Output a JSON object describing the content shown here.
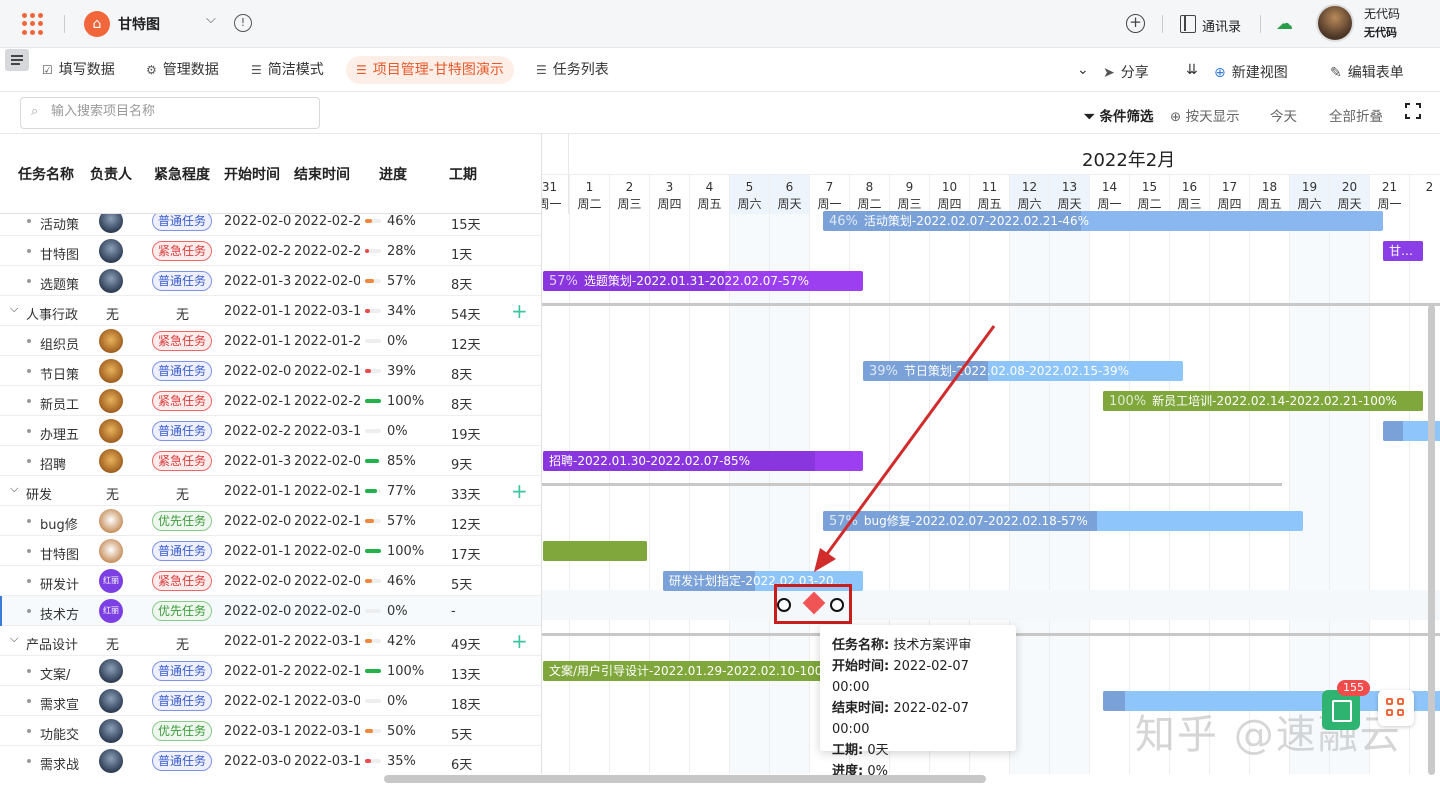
{
  "topbar": {
    "app_title": "甘特图",
    "contacts": "通讯录",
    "user_name": "无代码",
    "user_org": "无代码"
  },
  "tabs": [
    {
      "label": "填写数据",
      "icon": "form-icon"
    },
    {
      "label": "管理数据",
      "icon": "gear-icon"
    },
    {
      "label": "简洁模式",
      "icon": "gantt-icon"
    },
    {
      "label": "项目管理-甘特图演示",
      "icon": "gantt-icon",
      "active": true
    },
    {
      "label": "任务列表",
      "icon": "gantt-icon"
    }
  ],
  "tab_actions": {
    "share": "分享",
    "new_view": "新建视图",
    "edit_form": "编辑表单"
  },
  "toolbar": {
    "search_placeholder": "输入搜索项目名称",
    "filter": "条件筛选",
    "by_day": "按天显示",
    "today": "今天",
    "collapse_all": "全部折叠"
  },
  "columns": [
    "任务名称",
    "负责人",
    "紧急程度",
    "开始时间",
    "结束时间",
    "进度",
    "工期"
  ],
  "rows": [
    {
      "type": "task",
      "name": "活动策",
      "owner": "city",
      "owner_label": "",
      "priority": "普通任务",
      "ptype": "normal",
      "start": "2022-02-0",
      "end": "2022-02-2",
      "progress": "46%",
      "pval": 46,
      "dur": "15天"
    },
    {
      "type": "task",
      "name": "甘特图",
      "owner": "city",
      "owner_label": "",
      "priority": "紧急任务",
      "ptype": "urgent",
      "start": "2022-02-2",
      "end": "2022-02-2",
      "progress": "28%",
      "pval": 28,
      "dur": "1天"
    },
    {
      "type": "task",
      "name": "选题策",
      "owner": "city",
      "owner_label": "",
      "priority": "普通任务",
      "ptype": "normal",
      "start": "2022-01-3",
      "end": "2022-02-0",
      "progress": "57%",
      "pval": 57,
      "dur": "8天"
    },
    {
      "type": "group",
      "name": "人事行政",
      "owner_text": "无",
      "priority_text": "无",
      "start": "2022-01-1",
      "end": "2022-03-1",
      "progress": "34%",
      "pval": 34,
      "dur": "54天"
    },
    {
      "type": "task",
      "name": "组织员",
      "owner": "lion",
      "owner_label": "",
      "priority": "紧急任务",
      "ptype": "urgent",
      "start": "2022-01-1",
      "end": "2022-01-2",
      "progress": "0%",
      "pval": 0,
      "dur": "12天"
    },
    {
      "type": "task",
      "name": "节日策",
      "owner": "lion",
      "owner_label": "",
      "priority": "普通任务",
      "ptype": "normal",
      "start": "2022-02-0",
      "end": "2022-02-1",
      "progress": "39%",
      "pval": 39,
      "dur": "8天"
    },
    {
      "type": "task",
      "name": "新员工",
      "owner": "lion",
      "owner_label": "",
      "priority": "紧急任务",
      "ptype": "urgent",
      "start": "2022-02-1",
      "end": "2022-02-2",
      "progress": "100%",
      "pval": 100,
      "dur": "8天"
    },
    {
      "type": "task",
      "name": "办理五",
      "owner": "lion",
      "owner_label": "",
      "priority": "普通任务",
      "ptype": "normal",
      "start": "2022-02-2",
      "end": "2022-03-1",
      "progress": "0%",
      "pval": 0,
      "dur": "19天"
    },
    {
      "type": "task",
      "name": "招聘",
      "owner": "lion",
      "owner_label": "",
      "priority": "紧急任务",
      "ptype": "urgent",
      "start": "2022-01-3",
      "end": "2022-02-0",
      "progress": "85%",
      "pval": 85,
      "dur": "9天"
    },
    {
      "type": "group",
      "name": "研发",
      "owner_text": "无",
      "priority_text": "无",
      "start": "2022-01-1",
      "end": "2022-02-1",
      "progress": "77%",
      "pval": 77,
      "dur": "33天"
    },
    {
      "type": "task",
      "name": "bug修",
      "owner": "dog",
      "owner_label": "",
      "priority": "优先任务",
      "ptype": "prior",
      "start": "2022-02-0",
      "end": "2022-02-1",
      "progress": "57%",
      "pval": 57,
      "dur": "12天"
    },
    {
      "type": "task",
      "name": "甘特图",
      "owner": "dog",
      "owner_label": "",
      "priority": "普通任务",
      "ptype": "normal",
      "start": "2022-01-1",
      "end": "2022-02-0",
      "progress": "100%",
      "pval": 100,
      "dur": "17天"
    },
    {
      "type": "task",
      "name": "研发计",
      "owner": "red",
      "owner_label": "红丽",
      "priority": "紧急任务",
      "ptype": "urgent",
      "start": "2022-02-0",
      "end": "2022-02-0",
      "progress": "46%",
      "pval": 46,
      "dur": "5天"
    },
    {
      "type": "task",
      "name": "技术方",
      "owner": "red",
      "owner_label": "红丽",
      "priority": "优先任务",
      "ptype": "prior",
      "start": "2022-02-0",
      "end": "2022-02-0",
      "progress": "0%",
      "pval": 0,
      "dur": "-",
      "selected": true
    },
    {
      "type": "group",
      "name": "产品设计",
      "owner_text": "无",
      "priority_text": "无",
      "start": "2022-01-2",
      "end": "2022-03-1",
      "progress": "42%",
      "pval": 42,
      "dur": "49天"
    },
    {
      "type": "task",
      "name": "文案/",
      "owner": "city",
      "owner_label": "",
      "priority": "普通任务",
      "ptype": "normal",
      "start": "2022-01-2",
      "end": "2022-02-1",
      "progress": "100%",
      "pval": 100,
      "dur": "13天"
    },
    {
      "type": "task",
      "name": "需求宣",
      "owner": "city",
      "owner_label": "",
      "priority": "普通任务",
      "ptype": "normal",
      "start": "2022-02-1",
      "end": "2022-03-0",
      "progress": "0%",
      "pval": 0,
      "dur": "18天"
    },
    {
      "type": "task",
      "name": "功能交",
      "owner": "city",
      "owner_label": "",
      "priority": "优先任务",
      "ptype": "prior",
      "start": "2022-03-1",
      "end": "2022-03-1",
      "progress": "50%",
      "pval": 50,
      "dur": "5天"
    },
    {
      "type": "task",
      "name": "需求战",
      "owner": "city",
      "owner_label": "",
      "priority": "普通任务",
      "ptype": "normal",
      "start": "2022-03-0",
      "end": "2022-03-1",
      "progress": "35%",
      "pval": 35,
      "dur": "6天"
    }
  ],
  "gantt": {
    "month_label": "2022年2月",
    "days": [
      {
        "d": "31",
        "w": "周一"
      },
      {
        "d": "1",
        "w": "周二"
      },
      {
        "d": "2",
        "w": "周三"
      },
      {
        "d": "3",
        "w": "周四"
      },
      {
        "d": "4",
        "w": "周五"
      },
      {
        "d": "5",
        "w": "周六",
        "we": true
      },
      {
        "d": "6",
        "w": "周天",
        "we": true
      },
      {
        "d": "7",
        "w": "周一"
      },
      {
        "d": "8",
        "w": "周二"
      },
      {
        "d": "9",
        "w": "周三"
      },
      {
        "d": "10",
        "w": "周四"
      },
      {
        "d": "11",
        "w": "周五"
      },
      {
        "d": "12",
        "w": "周六",
        "we": true
      },
      {
        "d": "13",
        "w": "周天",
        "we": true
      },
      {
        "d": "14",
        "w": "周一"
      },
      {
        "d": "15",
        "w": "周二"
      },
      {
        "d": "16",
        "w": "周三"
      },
      {
        "d": "17",
        "w": "周四"
      },
      {
        "d": "18",
        "w": "周五"
      },
      {
        "d": "19",
        "w": "周六",
        "we": true
      },
      {
        "d": "20",
        "w": "周天",
        "we": true
      },
      {
        "d": "21",
        "w": "周一"
      },
      {
        "d": "2",
        "w": ""
      }
    ],
    "bars": [
      {
        "row": 0,
        "start": 7,
        "end": 21,
        "fill": 0.46,
        "color": "#8ab7ef",
        "fillcolor": "#7aa2d8",
        "label": "活动策划-2022.02.07-2022.02.21-46%",
        "pct": "46%"
      },
      {
        "row": 1,
        "start": 21,
        "end": 22,
        "fill": 1,
        "color": "#8a3ee6",
        "fillcolor": "#8a3ee6",
        "label": "甘…",
        "pct": ""
      },
      {
        "row": 2,
        "start": 0,
        "end": 8,
        "fill": 0.57,
        "color": "#9b3ff0",
        "fillcolor": "#8a36df",
        "label": "选题策划-2022.01.31-2022.02.07-57%",
        "pct": "57%"
      },
      {
        "row": 5,
        "start": 8,
        "end": 16,
        "fill": 0.39,
        "color": "#8ec5fb",
        "fillcolor": "#7aa2d8",
        "label": "节日策划-2022.02.08-2022.02.15-39%",
        "pct": "39%"
      },
      {
        "row": 6,
        "start": 14,
        "end": 22,
        "fill": 1,
        "color": "#7fa73c",
        "fillcolor": "#7fa73c",
        "label": "新员工培训-2022.02.14-2022.02.21-100%",
        "pct": "100%"
      },
      {
        "row": 7,
        "start": 21,
        "end": 23,
        "fill": 0.25,
        "color": "#8ec5fb",
        "fillcolor": "#7aa2d8",
        "label": "",
        "pct": ""
      },
      {
        "row": 8,
        "start": 0,
        "end": 8,
        "fill": 0.85,
        "color": "#9b3ff0",
        "fillcolor": "#8a36df",
        "label": "招聘-2022.01.30-2022.02.07-85%",
        "pct": ""
      },
      {
        "row": 10,
        "start": 7,
        "end": 19,
        "fill": 0.57,
        "color": "#8ec5fb",
        "fillcolor": "#7aa2d8",
        "label": "bug修复-2022.02.07-2022.02.18-57%",
        "pct": "57%"
      },
      {
        "row": 11,
        "start": 0,
        "end": 2.6,
        "fill": 1,
        "color": "#7fa73c",
        "fillcolor": "#7fa73c",
        "label": "",
        "pct": ""
      },
      {
        "row": 12,
        "start": 3,
        "end": 8,
        "fill": 0.46,
        "color": "#8ec5fb",
        "fillcolor": "#7aa2d8",
        "label": "研发计划指定-2022.02.03-20…",
        "pct": ""
      },
      {
        "row": 15,
        "start": 0,
        "end": 8,
        "fill": 1,
        "color": "#7fa73c",
        "fillcolor": "#7fa73c",
        "label": "文案/用户引导设计-2022.01.29-2022.02.10-100%",
        "pct": ""
      },
      {
        "row": 16,
        "start": 14,
        "end": 23,
        "fill": 0.06,
        "color": "#8ec5fb",
        "fillcolor": "#7aa2d8",
        "label": "",
        "pct": ""
      }
    ],
    "group_lines": [
      {
        "row": 3,
        "start": 0,
        "end": 23
      },
      {
        "row": 9,
        "start": 0,
        "end": 18.5
      },
      {
        "row": 14,
        "start": 0,
        "end": 23
      }
    ]
  },
  "tooltip": {
    "name_label": "任务名称:",
    "name_value": "技术方案评审",
    "start_label": "开始时间:",
    "start_value": "2022-02-07 00:00",
    "end_label": "结束时间:",
    "end_value": "2022-02-07 00:00",
    "dur_label": "工期:",
    "dur_value": "0天",
    "progress_label": "进度:",
    "progress_value": "0%"
  },
  "watermark": "知乎 @速融云",
  "fab": {
    "count": "155"
  },
  "colors": {
    "accent": "#e85a2b",
    "urgent": "#d93b3b",
    "normal": "#3b5ccc",
    "prior": "#3c9a3c",
    "progress_low": "#f2883b",
    "progress_mid": "#e84b4b",
    "progress_full": "#22b24c"
  }
}
